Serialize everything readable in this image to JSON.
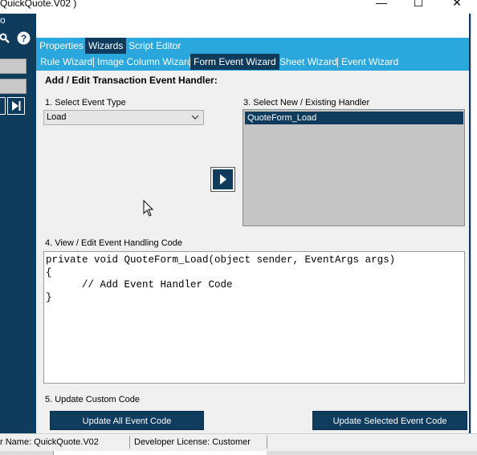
{
  "window": {
    "title": "QuickQuote.V02 )",
    "controls": {
      "minimize": "—",
      "maximize": "☐",
      "close": "✕"
    }
  },
  "left": {
    "menu_glyph": "o",
    "nav_next_glyph": "▶|",
    "nav_prev_glyph": "|"
  },
  "tabs": {
    "primary": [
      "Properties",
      "Wizards",
      "Script Editor"
    ],
    "primary_active": "Wizards",
    "secondary": [
      "Rule Wizard",
      "Image Column Wizard",
      "Form Event Wizard",
      "Sheet Wizard",
      "Event Wizard"
    ],
    "secondary_active": "Form Event Wizard"
  },
  "form": {
    "heading": "Add / Edit Transaction Event Handler:",
    "step1_label": "1. Select Event Type",
    "event_type_value": "Load",
    "step3_label": "3. Select New / Existing Handler",
    "handlers": [
      "QuoteForm_Load"
    ],
    "step4_label": "4. View / Edit Event Handling Code",
    "code_lines": [
      "private void QuoteForm_Load(object sender, EventArgs args)",
      "{",
      "      // Add Event Handler Code",
      "}"
    ],
    "step5_label": "5. Update Custom Code",
    "update_all_label": "Update All Event Code",
    "update_selected_label": "Update Selected Event Code"
  },
  "status": {
    "customization_name": "r Name:  QuickQuote.V02",
    "license": "Developer License:  Customer"
  },
  "colors": {
    "accent": "#2aa7dc",
    "navy": "#0f3b5c",
    "panel": "#f0f0f0",
    "listbox": "#c6c6c6"
  }
}
